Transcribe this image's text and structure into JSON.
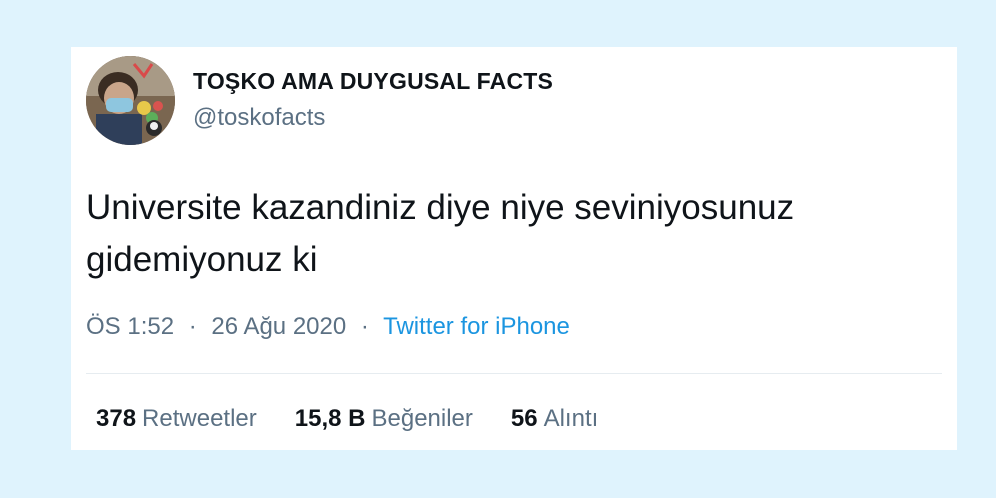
{
  "author": {
    "display_name": "TOŞKO AMA DUYGUSAL FACTS",
    "handle": "@toskofacts",
    "avatar_icon": "profile-photo-icon"
  },
  "tweet": {
    "lines": [
      "Universite kazandiniz diye niye seviniyosunuz",
      "gidemiyonuz ki"
    ]
  },
  "meta": {
    "time": "ÖS 1:52",
    "separator": "·",
    "date": "26 Ağu 2020",
    "source": "Twitter for iPhone"
  },
  "stats": {
    "retweets": {
      "count": "378",
      "label": "Retweetler"
    },
    "likes": {
      "count": "15,8 B",
      "label": "Beğeniler"
    },
    "quotes": {
      "count": "56",
      "label": "Alıntı"
    }
  },
  "colors": {
    "background": "#dff3fd",
    "card": "#ffffff",
    "text": "#0f1419",
    "secondary": "#5b7083",
    "link": "#1b95e0"
  }
}
